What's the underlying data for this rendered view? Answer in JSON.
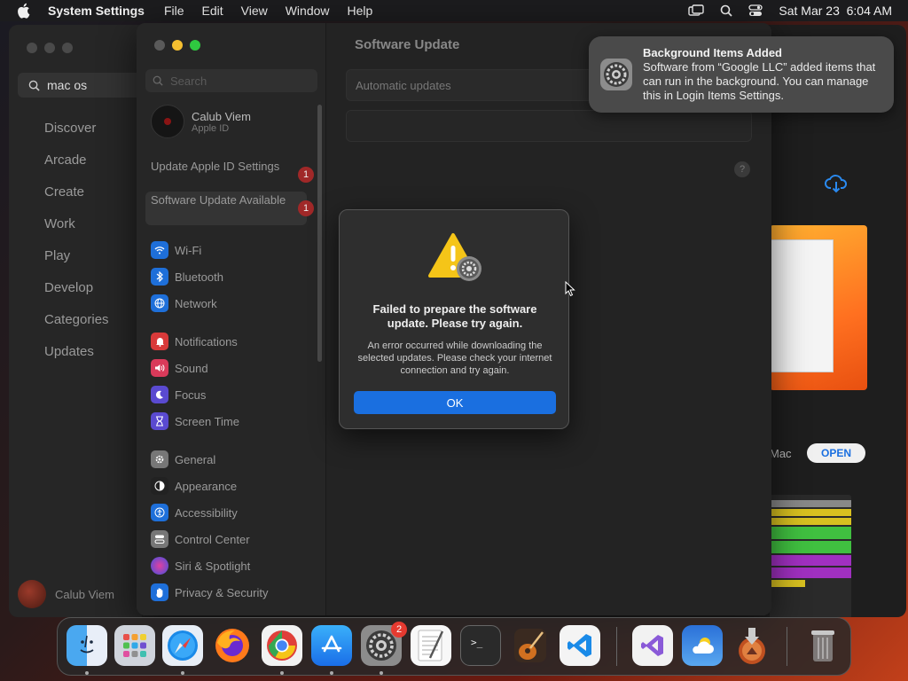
{
  "menubar": {
    "app_name": "System Settings",
    "menus": [
      "File",
      "Edit",
      "View",
      "Window",
      "Help"
    ],
    "datetime": "Sat Mar 23  6:04 AM"
  },
  "appstore": {
    "search_value": "mac os",
    "nav": [
      "Discover",
      "Arcade",
      "Create",
      "Work",
      "Play",
      "Develop",
      "Categories",
      "Updates"
    ],
    "user_name": "Calub Viem",
    "mac_label": "Mac",
    "open_label": "OPEN"
  },
  "settings": {
    "search_placeholder": "Search",
    "profile_name": "Calub Viem",
    "profile_sub": "Apple ID",
    "notice1": "Update Apple ID Settings",
    "notice1_badge": "1",
    "notice2": "Software Update Available",
    "notice2_badge": "1",
    "items": [
      {
        "label": "Wi-Fi",
        "icon": "wifi-icon",
        "color": "#1e6fd9"
      },
      {
        "label": "Bluetooth",
        "icon": "bluetooth-icon",
        "color": "#1e6fd9"
      },
      {
        "label": "Network",
        "icon": "globe-icon",
        "color": "#1e6fd9"
      },
      {
        "label": "Notifications",
        "icon": "bell-icon",
        "color": "#d93a3a"
      },
      {
        "label": "Sound",
        "icon": "speaker-icon",
        "color": "#d93a5a"
      },
      {
        "label": "Focus",
        "icon": "moon-icon",
        "color": "#5a4ad0"
      },
      {
        "label": "Screen Time",
        "icon": "hourglass-icon",
        "color": "#5a4ad0"
      },
      {
        "label": "General",
        "icon": "gear-icon",
        "color": "#777777"
      },
      {
        "label": "Appearance",
        "icon": "appearance-icon",
        "color": "#222222"
      },
      {
        "label": "Accessibility",
        "icon": "accessibility-icon",
        "color": "#1e6fd9"
      },
      {
        "label": "Control Center",
        "icon": "control-center-icon",
        "color": "#777777"
      },
      {
        "label": "Siri & Spotlight",
        "icon": "siri-icon",
        "color": "#b04ad0"
      },
      {
        "label": "Privacy & Security",
        "icon": "hand-icon",
        "color": "#1e6fd9"
      }
    ],
    "main_title": "Software Update",
    "auto_updates_label": "Automatic updates",
    "help_label": "?"
  },
  "alert": {
    "title": "Failed to prepare the software update. Please try again.",
    "message": "An error occurred while downloading the selected updates. Please check your internet connection and try again.",
    "ok_label": "OK"
  },
  "notification": {
    "title": "Background Items Added",
    "body": "Software from “Google LLC” added items that can run in the background. You can manage this in Login Items Settings."
  },
  "dock": {
    "apps": [
      "Finder",
      "Launchpad",
      "Safari",
      "Firefox",
      "Chrome",
      "App Store",
      "System Settings",
      "TextEdit",
      "Terminal",
      "GarageBand",
      "Visual Studio Code",
      "Visual Studio",
      "Weather",
      "macOS Installer",
      "Trash"
    ],
    "settings_badge": "2"
  },
  "colors": {
    "accent": "#1a6fe0",
    "badge": "#e53a30"
  }
}
